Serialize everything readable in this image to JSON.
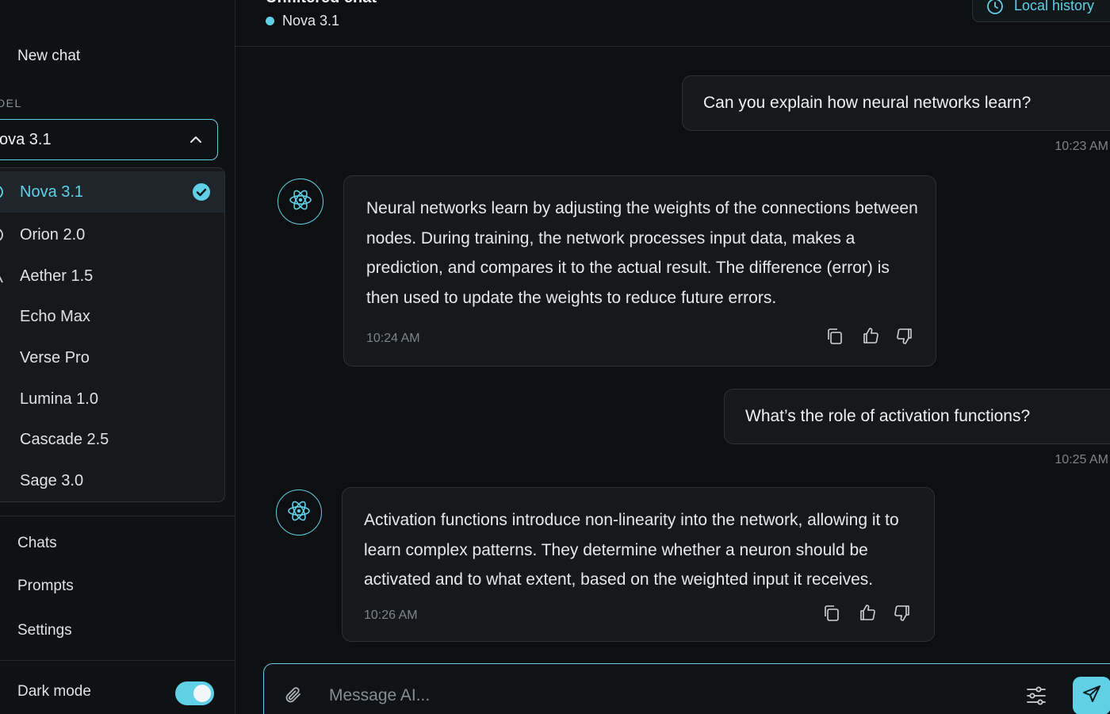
{
  "sidebar": {
    "new_chat": "New chat",
    "model_label": "DEL",
    "model_select": {
      "value": "ova 3.1"
    },
    "models": [
      {
        "label": "Nova 3.1",
        "selected": true
      },
      {
        "label": "Orion 2.0"
      },
      {
        "label": "Aether 1.5"
      },
      {
        "label": "Echo Max"
      },
      {
        "label": "Verse Pro"
      },
      {
        "label": "Lumina 1.0"
      },
      {
        "label": "Cascade 2.5"
      },
      {
        "label": "Sage 3.0"
      }
    ],
    "nav": [
      "Chats",
      "Prompts",
      "Settings"
    ],
    "dark_mode_label": "Dark mode",
    "dark_mode_on": true
  },
  "header": {
    "title": "Unfiltered chat",
    "model_status": "Nova 3.1",
    "local_history": "Local history"
  },
  "messages": [
    {
      "role": "user",
      "text": "Can you explain how neural networks learn?",
      "time": "10:23 AM"
    },
    {
      "role": "assistant",
      "text": "Neural networks learn by adjusting the weights of the connections between nodes. During training, the network processes input data, makes a prediction, and compares it to the actual result. The difference (error) is then used to update the weights to reduce future errors.",
      "time": "10:24 AM"
    },
    {
      "role": "user",
      "text": "What’s the role of activation functions?",
      "time": "10:25 AM"
    },
    {
      "role": "assistant",
      "text": "Activation functions introduce non-linearity into the network, allowing it to learn complex patterns. They determine whether a neuron should be activated and to what extent, based on the weighted input it receives.",
      "time": "10:26 AM"
    }
  ],
  "composer": {
    "placeholder": "Message AI..."
  },
  "theme": {
    "accent": "#5fd0e6",
    "background": "#0d0f10",
    "surface": "#16191c"
  },
  "icons": [
    "chevron-up-icon",
    "check-circle-icon",
    "atom-icon",
    "clock-icon",
    "copy-icon",
    "thumbs-up-icon",
    "thumbs-down-icon",
    "paperclip-icon",
    "sliders-icon",
    "send-icon"
  ]
}
